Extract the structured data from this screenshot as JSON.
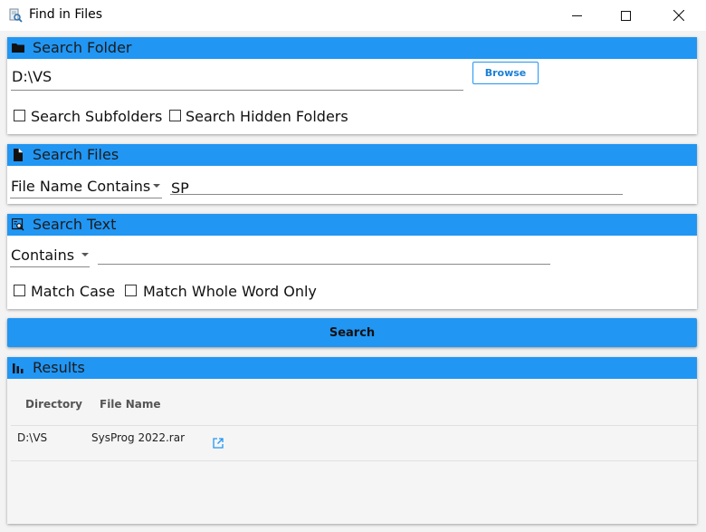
{
  "window": {
    "title": "Find in Files"
  },
  "search_folder": {
    "header": "Search Folder",
    "path_value": "D:\\VS",
    "browse_label": "Browse",
    "subfolders_label": "Search Subfolders",
    "subfolders_checked": false,
    "hidden_label": "Search Hidden Folders",
    "hidden_checked": false
  },
  "search_files": {
    "header": "Search Files",
    "mode_selected": "File Name Contains",
    "pattern_value": "SP"
  },
  "search_text": {
    "header": "Search Text",
    "mode_selected": "Contains",
    "text_value": "",
    "match_case_label": "Match Case",
    "match_case_checked": false,
    "whole_word_label": "Match Whole Word Only",
    "whole_word_checked": false
  },
  "search_button": {
    "label": "Search"
  },
  "results": {
    "header": "Results",
    "columns": [
      "Directory",
      "File Name"
    ],
    "rows": [
      {
        "directory": "D:\\VS",
        "file_name": "SysProg 2022.rar",
        "action_icon": "open-external-icon"
      }
    ]
  },
  "colors": {
    "accent": "#2196f3",
    "link": "#1a7fd6"
  }
}
